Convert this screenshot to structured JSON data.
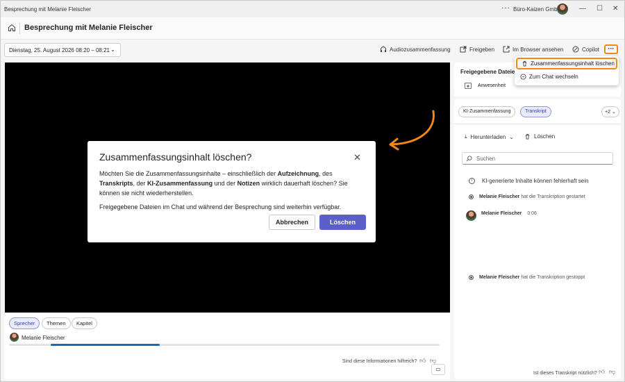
{
  "window": {
    "title": "Besprechung mit Melanie Fleischer",
    "ellipsis": "···",
    "org": "Büro-Kaizen GmbH",
    "minimize": "—",
    "maximize": "☐",
    "close": "✕"
  },
  "header": {
    "title": "Besprechung mit Melanie Fleischer"
  },
  "toolbar": {
    "date_label": "Dienstag, 25. August 2026 08:20 – 08:21",
    "audio_summary": "Audiozusammenfassung",
    "share": "Freigeben",
    "open_browser": "Im Browser ansehen",
    "copilot": "Copilot",
    "more": "···"
  },
  "menu": {
    "items": [
      {
        "label": "Zusammenfassungsinhalt löschen"
      },
      {
        "label": "Zum Chat wechseln"
      }
    ]
  },
  "dialog": {
    "title": "Zusammenfassungsinhalt löschen?",
    "body_1": "Möchten Sie die Zusammenfassungsinhalte – einschließlich der ",
    "body_b1": "Aufzeichnung",
    "body_2": ", des ",
    "body_b2": "Transkripts",
    "body_3": ", der ",
    "body_b3": "KI-Zusammenfassung",
    "body_4": " und der ",
    "body_b4": "Notizen",
    "body_5": " wirklich dauerhaft löschen? Sie können sie nicht wiederherstellen.",
    "body_secondary": "Freigegebene Dateien im Chat und während der Besprechung sind weiterhin verfügbar.",
    "cancel": "Abbrechen",
    "delete": "Löschen"
  },
  "player": {
    "filters": [
      "Sprecher",
      "Themen",
      "Kapitel"
    ],
    "speaker_name": "Melanie Fleischer",
    "progress_fraction": 0.35,
    "helpful_question": "Sind diese Informationen hilfreich?"
  },
  "files": {
    "title": "Freigegebene Dateien",
    "item": "Anwesenheit"
  },
  "transcript": {
    "tabs": [
      "KI-Zusammenfassung",
      "Transkript",
      "+2"
    ],
    "download": "Herunterladen",
    "delete": "Löschen",
    "search_placeholder": "Suchen",
    "ai_notice": "KI-generierte Inhalte können fehlerhaft sein",
    "started_name": "Melanie Fleischer",
    "started_text": "hat die Transkription gestartet",
    "speaker_name": "Melanie Fleischer",
    "speaker_time": "0:06",
    "stopped_name": "Melanie Fleischer",
    "stopped_text": "hat die Transkription gestoppt",
    "useful_question": "Ist dieses Transkript nützlich?"
  },
  "colors": {
    "accent": "#5b5fc7",
    "highlight": "#f08a14",
    "progress": "#0f6cbd"
  }
}
